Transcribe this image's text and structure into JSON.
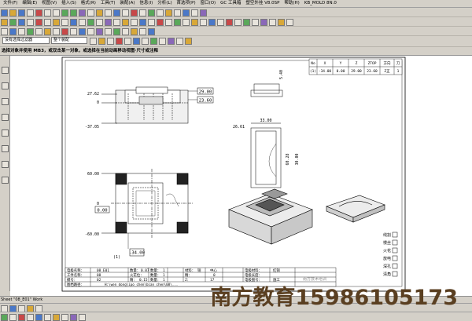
{
  "menu": [
    "文件(F)",
    "编辑(E)",
    "视图(V)",
    "插入(S)",
    "格式(R)",
    "工具(T)",
    "装配(A)",
    "信息(I)",
    "分析(L)",
    "首选项(P)",
    "窗口(O)",
    "GC 工具箱",
    "塑空外挂 V8.0SP",
    "帮助(H)",
    "KB_MOLD 8N.0"
  ],
  "toolbar": {
    "select_filter": "没有选择过滤器",
    "scope": "整个装配"
  },
  "prompt": "选择对象并使用 MB3，或双击某一对象，或选择在当前动画移动视图·尺寸或注释",
  "drawing": {
    "dims_front": {
      "top": "27.62",
      "zero": "0",
      "bottom": "-37.05",
      "box1": "29.00",
      "box2": "23.60"
    },
    "dims_plan": {
      "top": "60.00",
      "zero": "0",
      "bottom": "-60.00",
      "box_left": "0.00",
      "box_bottom": "-34.00",
      "tag": "(1)"
    },
    "dims_side": {
      "top_v": "5.40",
      "width": "33.00",
      "left": "26.61",
      "mid": "60.28",
      "right": "30.00"
    },
    "coord_table": {
      "headers": [
        "No",
        "X",
        "Y",
        "Z",
        "ZTOP",
        "方向",
        "刀"
      ],
      "row": [
        "(1)",
        "-34.00",
        "0.00",
        "29.00",
        "23.60",
        "Z正",
        "1"
      ]
    },
    "legend_right": [
      "线割",
      "慢丝",
      "火花",
      "放电",
      "深孔",
      "清角"
    ],
    "title_block": {
      "rows": [
        [
          "电极名称：",
          "08_E01",
          "数量：",
          "0.07",
          "数量：",
          "1",
          "材料：",
          "铜",
          "中心",
          "电极材料：",
          "红铜",
          "",
          ""
        ],
        [
          "工件名称：",
          "08",
          "火花位：",
          "",
          "数量：",
          "1",
          "精：",
          "",
          "0",
          "电极长度：",
          "",
          "",
          ""
        ],
        [
          "模号：",
          "02",
          "精：",
          "0.15",
          "数量：",
          "1",
          "Z：",
          "",
          "17",
          "电极图号：",
          "施工",
          "",
          ""
        ],
        [
          "图档路径：",
          "",
          "H:\\wen dong\\ipo chen\\bian chen\\08\\...",
          "",
          "",
          "",
          "",
          "",
          "",
          "",
          "",
          "",
          ""
        ]
      ]
    },
    "stamp": "南方技术培训"
  },
  "status": {
    "sheet": "Sheet \"08_E01\" Work"
  },
  "watermark": "南方教育15986105173",
  "colors": {
    "ui_bg": "#d4d0c8",
    "canvas": "#ffffff",
    "watermark": "#5a3f21",
    "dim_box": "#000000"
  }
}
